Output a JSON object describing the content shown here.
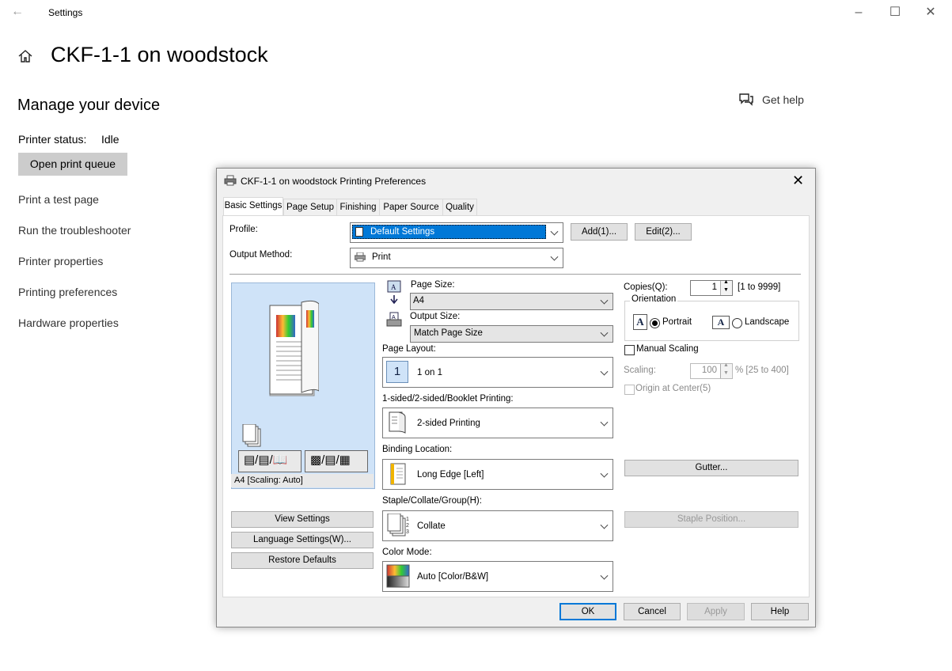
{
  "window": {
    "app_title": "Settings",
    "page_title": "CKF-1-1 on woodstock",
    "section_title": "Manage your device",
    "printer_status_label": "Printer status:",
    "printer_status_value": "Idle",
    "open_queue_label": "Open print queue",
    "links": [
      "Print a test page",
      "Run the troubleshooter",
      "Printer properties",
      "Printing preferences",
      "Hardware properties"
    ],
    "get_help": "Get help"
  },
  "dialog": {
    "title": "CKF-1-1 on woodstock Printing Preferences",
    "tabs": [
      "Basic Settings",
      "Page Setup",
      "Finishing",
      "Paper Source",
      "Quality"
    ],
    "profile_label": "Profile:",
    "profile_value": "Default Settings",
    "add_button": "Add(1)...",
    "edit_button": "Edit(2)...",
    "output_method_label": "Output Method:",
    "output_method_value": "Print",
    "preview_caption": "A4 [Scaling: Auto]",
    "page_size_label": "Page Size:",
    "page_size_value": "A4",
    "output_size_label": "Output Size:",
    "output_size_value": "Match Page Size",
    "page_layout_label": "Page Layout:",
    "page_layout_value": "1 on 1",
    "page_layout_icon_text": "1",
    "sided_label": "1-sided/2-sided/Booklet Printing:",
    "sided_value": "2-sided Printing",
    "binding_label": "Binding Location:",
    "binding_value": "Long Edge [Left]",
    "staple_label": "Staple/Collate/Group(H):",
    "staple_value": "Collate",
    "color_label": "Color Mode:",
    "color_value": "Auto [Color/B&W]",
    "copies_label": "Copies(Q):",
    "copies_value": "1",
    "copies_range": "[1 to 9999]",
    "orientation_label": "Orientation",
    "portrait_label": "Portrait",
    "landscape_label": "Landscape",
    "manual_scaling_label": "Manual Scaling",
    "scaling_label": "Scaling:",
    "scaling_value": "100",
    "scaling_range": "% [25 to 400]",
    "origin_label": "Origin at Center(5)",
    "gutter_button": "Gutter...",
    "staple_position_button": "Staple Position...",
    "view_settings_button": "View Settings",
    "language_settings_button": "Language Settings(W)...",
    "restore_defaults_button": "Restore Defaults",
    "ok_button": "OK",
    "cancel_button": "Cancel",
    "apply_button": "Apply",
    "help_button": "Help",
    "colors": {
      "accent": "#0078d7",
      "selected_bg": "#0078d7"
    }
  }
}
